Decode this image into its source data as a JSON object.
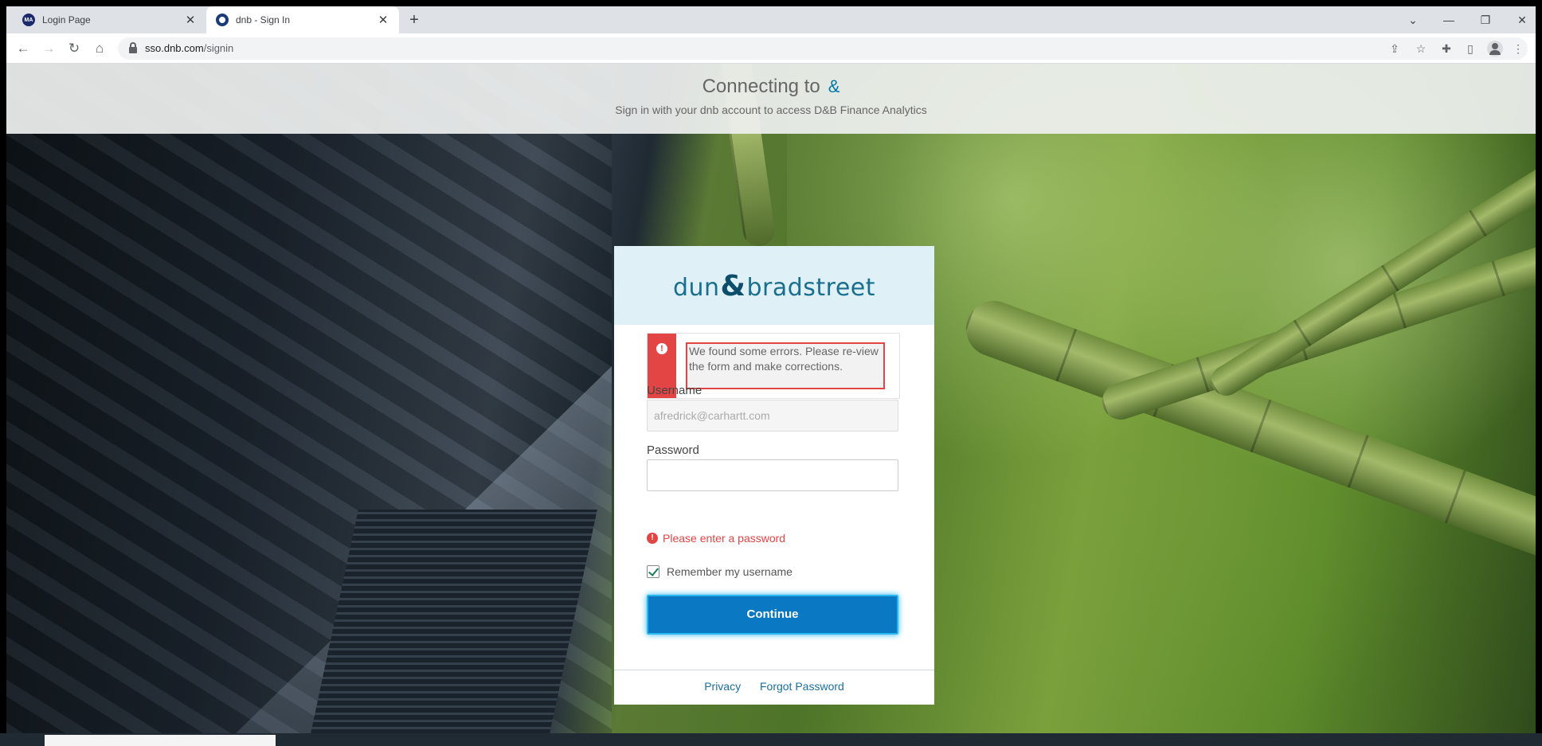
{
  "browser": {
    "tabs": [
      {
        "title": "Login Page",
        "favicon": "MA",
        "active": false
      },
      {
        "title": "dnb - Sign In",
        "active": true
      }
    ],
    "url_host": "sso.dnb.com",
    "url_path": "/signin"
  },
  "header": {
    "connecting": "Connecting to",
    "connecting_logo": "&",
    "subtitle": "Sign in with your dnb account to access D&B Finance Analytics"
  },
  "logo": {
    "left": "dun",
    "amp": "&",
    "right": "bradstreet"
  },
  "error": {
    "message": "We found some errors. Please re-view the form and make corrections."
  },
  "form": {
    "username_label": "Username",
    "username_value": "afredrick@carhartt.com",
    "password_label": "Password",
    "password_error": "Please enter a password",
    "remember_label": "Remember my username",
    "remember_checked": true,
    "continue_label": "Continue"
  },
  "footer": {
    "privacy": "Privacy",
    "forgot": "Forgot Password"
  },
  "colors": {
    "accent": "#0a78c2",
    "error": "#e34444",
    "brand": "#1a6f8e"
  }
}
